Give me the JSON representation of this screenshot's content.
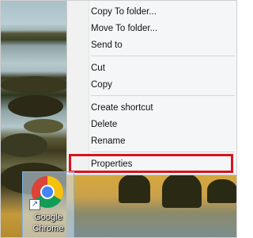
{
  "context_menu": {
    "items": [
      {
        "label": "Copy To folder..."
      },
      {
        "label": "Move To folder..."
      },
      {
        "label": "Send to"
      },
      {
        "label": "Cut"
      },
      {
        "label": "Copy"
      },
      {
        "label": "Create shortcut"
      },
      {
        "label": "Delete"
      },
      {
        "label": "Rename"
      },
      {
        "label": "Properties",
        "highlighted": true
      }
    ],
    "highlight_color": "#d8141b"
  },
  "desktop_icon": {
    "label_line1": "Google",
    "label_line2": "Chrome",
    "icon": "chrome-icon",
    "overlay_icon": "shortcut-arrow-icon",
    "selected": true
  }
}
